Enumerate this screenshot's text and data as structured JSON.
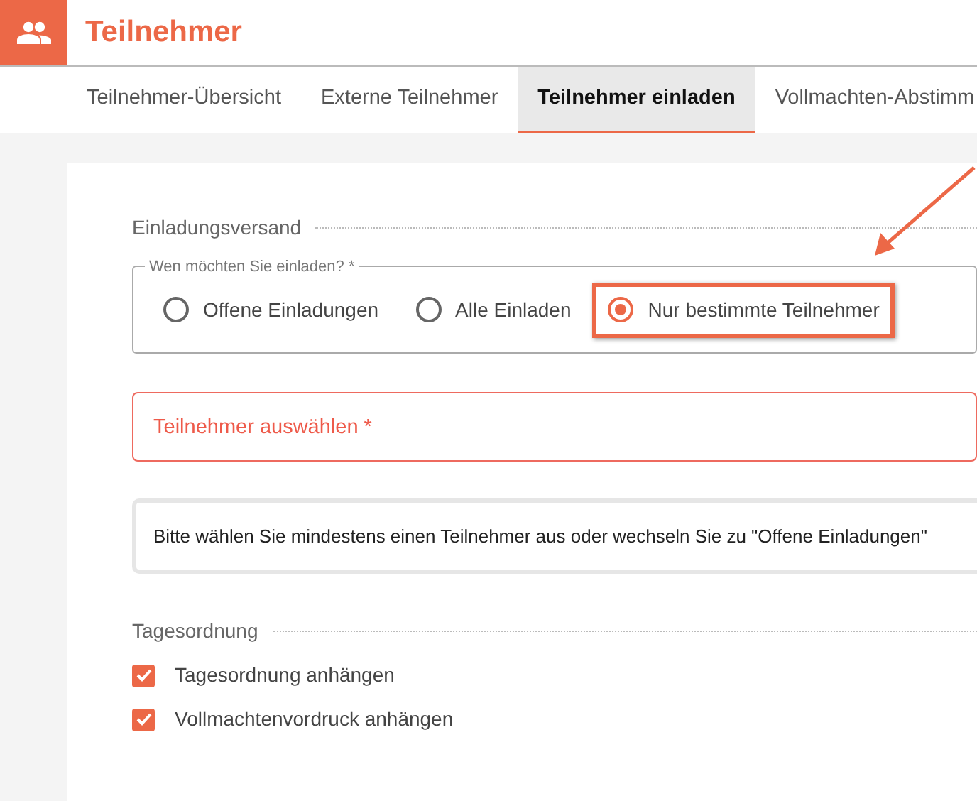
{
  "header": {
    "title": "Teilnehmer"
  },
  "tabs": [
    {
      "label": "Teilnehmer-Übersicht",
      "selected": false
    },
    {
      "label": "Externe Teilnehmer",
      "selected": false
    },
    {
      "label": "Teilnehmer einladen",
      "selected": true
    },
    {
      "label": "Vollmachten-Abstimm",
      "selected": false
    }
  ],
  "invite_section": {
    "title": "Einladungsversand",
    "group_legend": "Wen möchten Sie einladen? *",
    "options": [
      {
        "label": "Offene Einladungen",
        "selected": false,
        "highlighted": false
      },
      {
        "label": "Alle Einladen",
        "selected": false,
        "highlighted": false
      },
      {
        "label": "Nur bestimmte Teilnehmer",
        "selected": true,
        "highlighted": true
      }
    ]
  },
  "participant_field": {
    "placeholder": "Teilnehmer auswählen *",
    "invalid": true
  },
  "notice": "Bitte wählen Sie mindestens einen Teilnehmer aus oder wechseln Sie zu \"Offene Einladungen\"",
  "agenda_section": {
    "title": "Tagesordnung",
    "checkboxes": [
      {
        "label": "Tagesordnung anhängen",
        "checked": true
      },
      {
        "label": "Vollmachtenvordruck anhängen",
        "checked": true
      }
    ]
  }
}
